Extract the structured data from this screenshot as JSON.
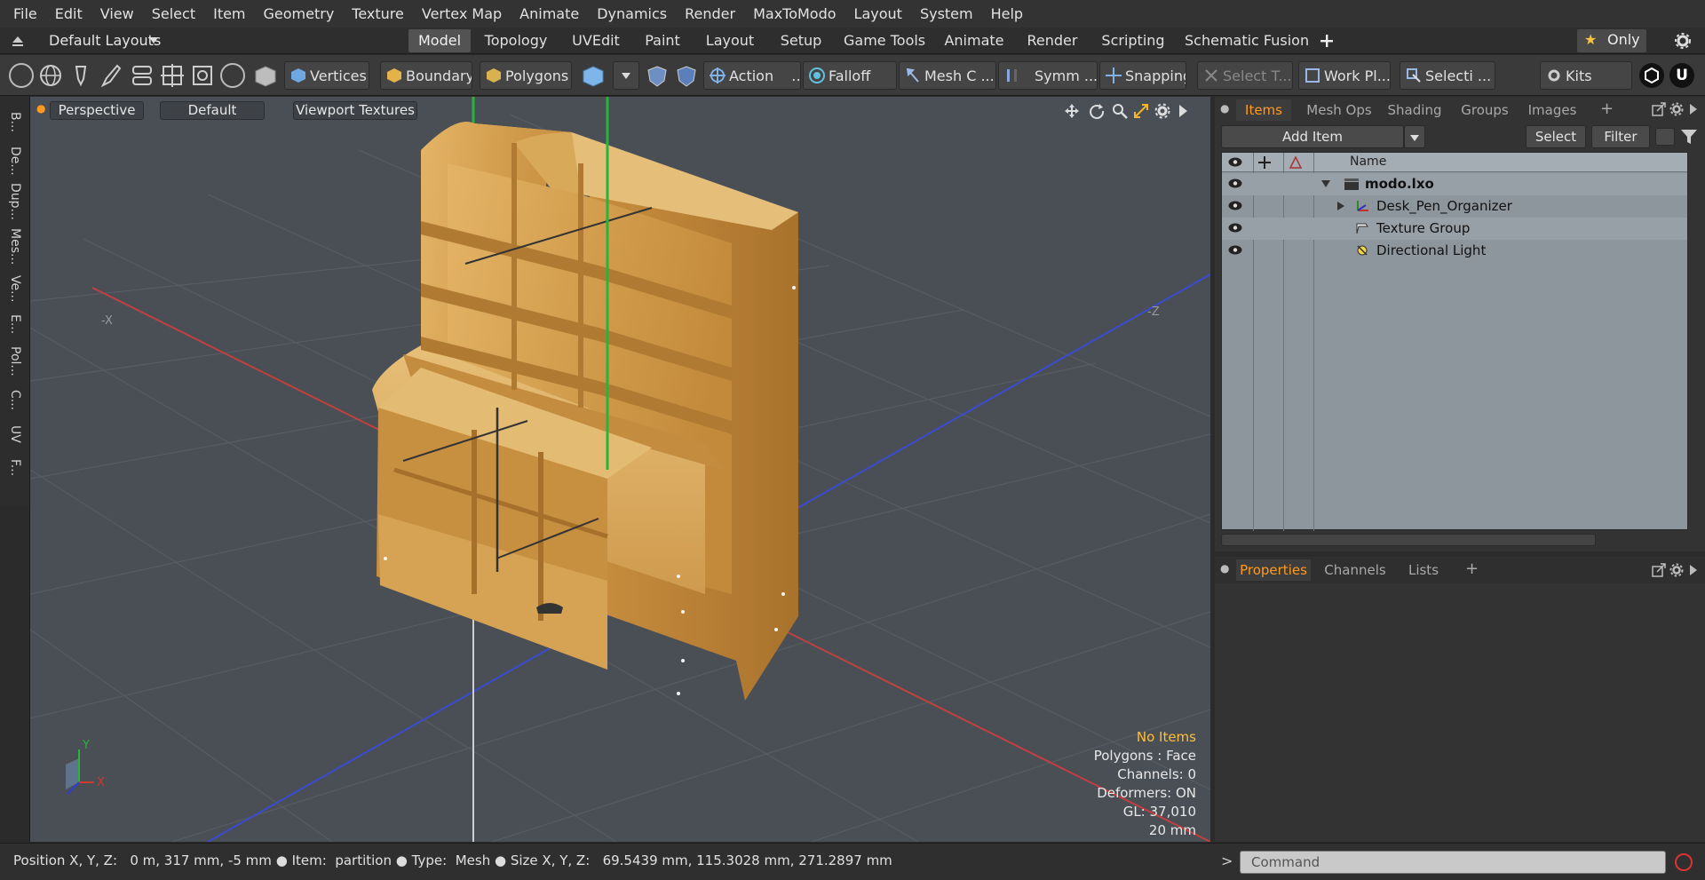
{
  "menubar": [
    "File",
    "Edit",
    "View",
    "Select",
    "Item",
    "Geometry",
    "Texture",
    "Vertex Map",
    "Animate",
    "Dynamics",
    "Render",
    "MaxToModo",
    "Layout",
    "System",
    "Help"
  ],
  "layout_selector": "Default Layouts",
  "layout_tabs": [
    "Model",
    "Topology",
    "UVEdit",
    "Paint",
    "Layout",
    "Setup",
    "Game Tools",
    "Animate",
    "Render",
    "Scripting",
    "Schematic Fusion"
  ],
  "active_layout_tab": "Model",
  "only_label": "Only",
  "toolbar": {
    "vertices": "Vertices",
    "boundary": "Boundary",
    "polygons": "Polygons",
    "action": "Action",
    "falloff": "Falloff",
    "mesh": "Mesh C ...",
    "symm": "Symm ...",
    "snapping": "Snapping",
    "select_t": "Select T...",
    "workplane": "Work Pl...",
    "selection": "Selecti ...",
    "kits": "Kits"
  },
  "left_tabs": [
    "B...",
    "De...",
    "Dup...",
    "Mes...",
    "Ve...",
    "E...",
    "Pol...",
    "C...",
    "UV",
    "F..."
  ],
  "viewport": {
    "view": "Perspective",
    "shading": "Default",
    "textures": "Viewport Textures",
    "axis_x": "-X",
    "axis_z": "-Z",
    "gizmo_y": "Y",
    "gizmo_x": "X",
    "info": {
      "items": "No Items",
      "polygons": "Polygons : Face",
      "channels": "Channels: 0",
      "deformers": "Deformers: ON",
      "gl": "GL: 37,010",
      "unit": "20 mm"
    }
  },
  "items_panel": {
    "tabs": [
      "Items",
      "Mesh Ops",
      "Shading",
      "Groups",
      "Images"
    ],
    "active": "Items",
    "add_item": "Add Item",
    "select": "Select",
    "filter": "Filter",
    "name_header": "Name",
    "tree": [
      {
        "label": "modo.lxo",
        "indent": 0
      },
      {
        "label": "Desk_Pen_Organizer",
        "indent": 1
      },
      {
        "label": "Texture Group",
        "indent": 1
      },
      {
        "label": "Directional Light",
        "indent": 1
      }
    ]
  },
  "props_panel": {
    "tabs": [
      "Properties",
      "Channels",
      "Lists"
    ],
    "active": "Properties"
  },
  "status": {
    "pos_label": "Position X, Y, Z:",
    "pos_value": "0 m, 317 mm, -5 mm",
    "item_label": "Item:",
    "item_value": "partition",
    "type_label": "Type:",
    "type_value": "Mesh",
    "size_label": "Size X, Y, Z:",
    "size_value": "69.5439 mm, 115.3028 mm, 271.2897 mm"
  },
  "command": {
    "placeholder": "Command",
    "prompt": ">"
  },
  "colors": {
    "accent": "#ff9a1f",
    "x_axis": "#d23a2a",
    "y_axis": "#2ac23a",
    "z_axis": "#2c3ed8",
    "wood": "#d9a556"
  }
}
